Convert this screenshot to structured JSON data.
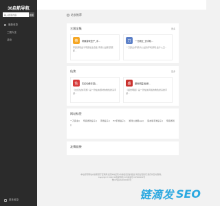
{
  "sidebar": {
    "logo": "36启航导航",
    "search_placeholder": "输入搜索内容",
    "search_button": "搜索",
    "nav": [
      {
        "label": "最新收录"
      },
      {
        "label": "三国大全"
      },
      {
        "label": "活动"
      }
    ],
    "bottom_label": "更多收录"
  },
  "site_recommend": "站长推荐",
  "sections": [
    {
      "title": "三国全集",
      "more": "更多",
      "items": [
        {
          "title": "帝霸游戏盒子_手...",
          "desc": "帝霸游戏盒子帝霸最全合集,手游公益服,安装即...",
          "thumb_color": "#f5a623",
          "thumb_char": "帝"
        },
        {
          "title": "一刀霸业_仿手机...",
          "desc": "一刀霸业(手游)为公益仿手机游戏,盒子入口...",
          "thumb_color": "#5b7fc7",
          "thumb_char": "刀"
        }
      ]
    },
    {
      "title": "仙侠",
      "more": "更多",
      "items": [
        {
          "title": "玄幻仙侠手游(...",
          "desc": "《玄幻仙侠手游》是一款仙侠题材的角色扮演手游...",
          "thumb_color": "#d63a3a",
          "thumb_char": "仙"
        },
        {
          "title": "盛世明星(仙侠...",
          "desc": "《盛世明星》是一款仙侠风格的角色扮演类手游...",
          "thumb_color": "#c9302c",
          "thumb_char": "盛"
        }
      ]
    }
  ],
  "tags_section": {
    "title": "网站标签",
    "tags": [
      "一刀霸业()",
      "帝霸游戏盒子()",
      "手游盒子()",
      "BT手游盒子()",
      "游戏公益服app()",
      "变态版手游盒子()",
      "帝霸游戏()"
    ]
  },
  "links_section": {
    "title": "友情链接"
  },
  "footer": {
    "line1": "本站所有网站内容来源于互联网,如果本站部分内容侵犯您的权益,请您告知我们,我们将及时删除。",
    "line2": "Copyright © 2023 36启航导航 ICP备案号:ICP000000号",
    "line3": "豫ICP备2022000000号"
  },
  "watermark": {
    "cn": "链滴发",
    "en": "SEO"
  }
}
